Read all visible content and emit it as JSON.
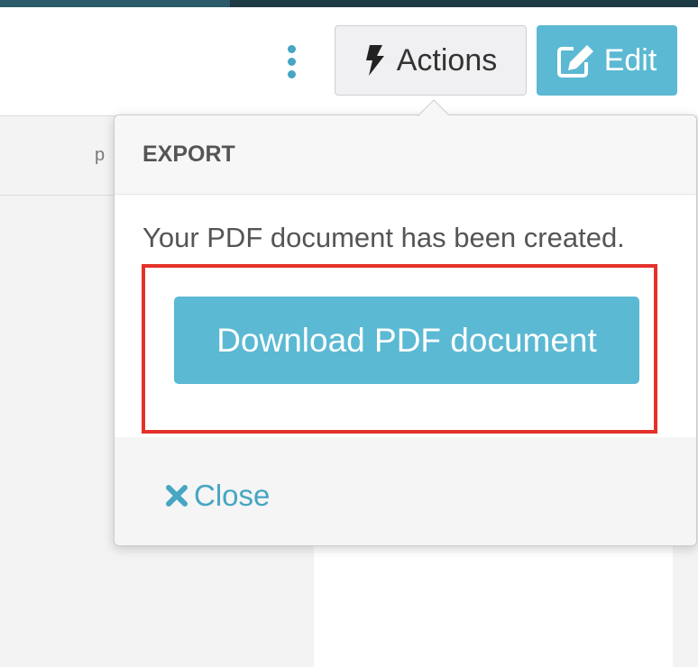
{
  "colors": {
    "accent": "#5bb9d3",
    "link": "#46a6c3",
    "highlight": "#e3322a",
    "top_bar": "#1e3a44"
  },
  "background": {
    "peek_text": "p"
  },
  "toolbar": {
    "more_icon": "vertical-ellipsis-icon",
    "actions_icon": "lightning-bolt-icon",
    "actions_label": "Actions",
    "edit_icon": "pencil-square-icon",
    "edit_label": "Edit"
  },
  "popover": {
    "title": "EXPORT",
    "message": "Your PDF document has been created.",
    "download_label": "Download PDF document",
    "close_icon": "x-icon",
    "close_label": "Close"
  }
}
